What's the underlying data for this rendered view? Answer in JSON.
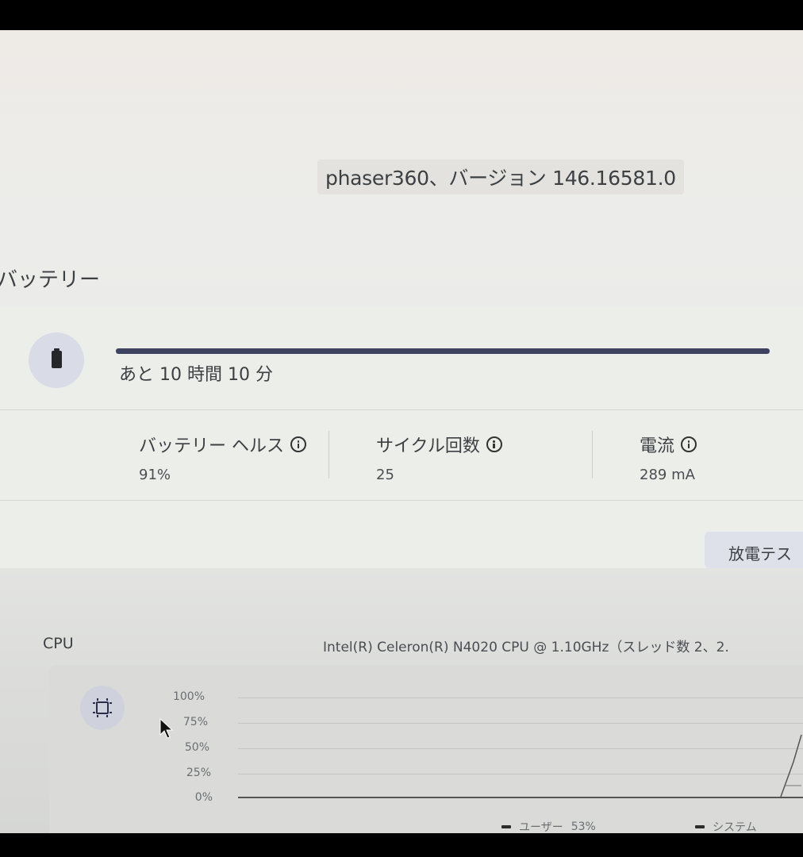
{
  "header": {
    "version_text": "phaser360、バージョン 146.16581.0"
  },
  "battery": {
    "section_title": "バッテリー",
    "icon": "battery-icon",
    "charge_fraction": 1.0,
    "time_remaining": "あと 10 時間 10 分",
    "stats": [
      {
        "label": "バッテリー ヘルス",
        "value": "91%"
      },
      {
        "label": "サイクル回数",
        "value": "25"
      },
      {
        "label": "電流",
        "value": "289 mA"
      }
    ],
    "discharge_button_label": "放電テス"
  },
  "cpu": {
    "section_title": "CPU",
    "model_text": "Intel(R) Celeron(R) N4020 CPU @ 1.10GHz（スレッド数 2、2.",
    "icon": "cpu-chip-icon",
    "y_ticks": [
      "100%",
      "75%",
      "50%",
      "25%",
      "0%"
    ],
    "legend": [
      {
        "name": "ユーザー",
        "value": "53%"
      },
      {
        "name": "システム",
        "value": ""
      }
    ]
  },
  "colors": {
    "progress_fill": "#3d4261",
    "icon_circle": "#d9dce6",
    "button_bg": "#dfe1ea"
  }
}
